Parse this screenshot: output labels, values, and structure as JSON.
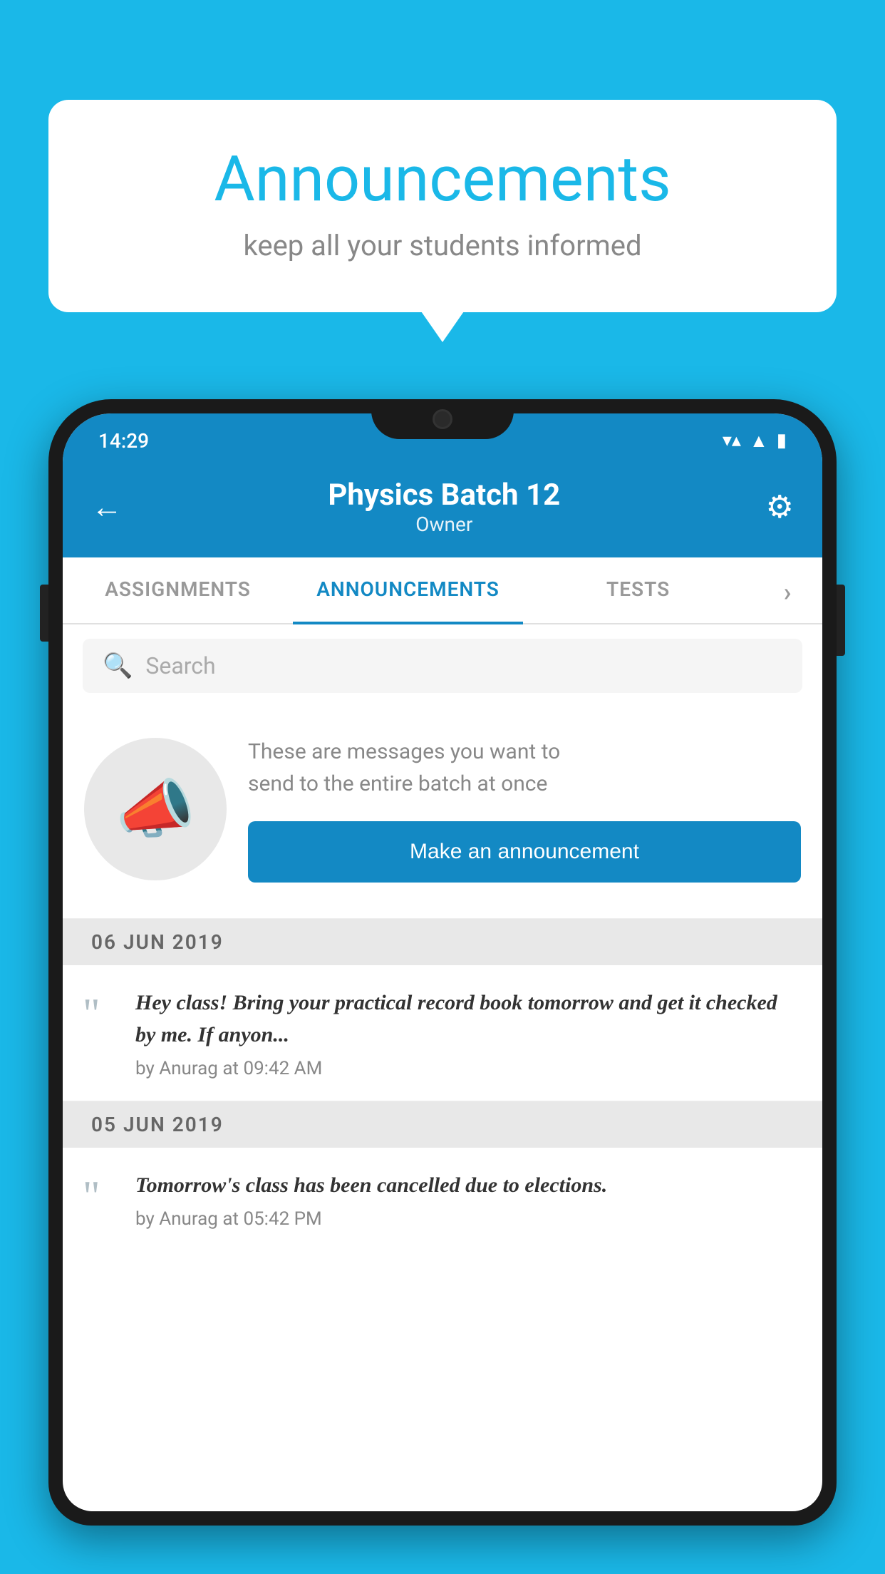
{
  "bubble": {
    "title": "Announcements",
    "subtitle": "keep all your students informed"
  },
  "status_bar": {
    "time": "14:29",
    "wifi": "▼",
    "signal": "▲",
    "battery": "▮"
  },
  "header": {
    "title": "Physics Batch 12",
    "subtitle": "Owner",
    "back_label": "←",
    "gear_label": "⚙"
  },
  "tabs": [
    {
      "label": "ASSIGNMENTS",
      "active": false
    },
    {
      "label": "ANNOUNCEMENTS",
      "active": true
    },
    {
      "label": "TESTS",
      "active": false
    },
    {
      "label": "›",
      "active": false
    }
  ],
  "search": {
    "placeholder": "Search"
  },
  "promo": {
    "description": "These are messages you want to\nsend to the entire batch at once",
    "button_label": "Make an announcement"
  },
  "date_dividers": [
    "06  JUN  2019",
    "05  JUN  2019"
  ],
  "announcements": [
    {
      "message": "Hey class! Bring your practical record book tomorrow and get it checked by me. If anyon...",
      "meta": "by Anurag at 09:42 AM"
    },
    {
      "message": "Tomorrow's class has been cancelled due to elections.",
      "meta": "by Anurag at 05:42 PM"
    }
  ]
}
